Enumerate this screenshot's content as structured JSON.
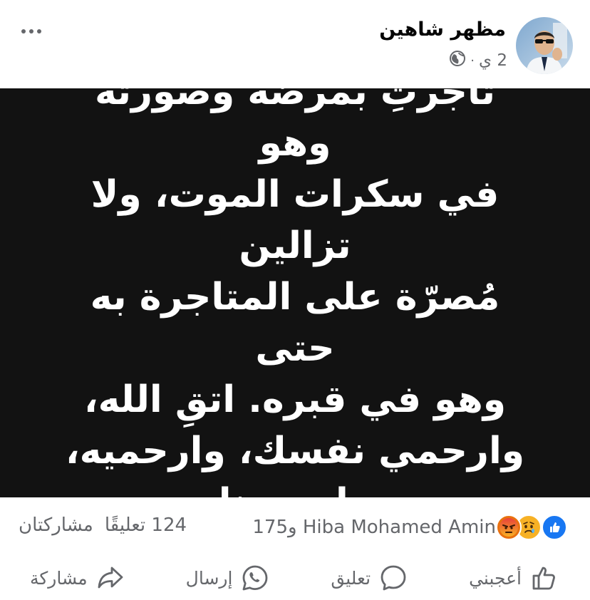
{
  "post": {
    "author": "مظهر شاهين",
    "time": "2 ي",
    "separator": "·",
    "privacy_icon": "globe-icon",
    "text_lines": [
      "تاجرتِ بمرضه وصورته وهو",
      "في سكرات الموت، ولا تزالين",
      "مُصرّة على المتاجرة به حتى",
      "وهو في قبره. اتقِ الله،",
      "وارحمي نفسك، وارحميه،",
      "وارحمينا"
    ],
    "background_color": "#121212"
  },
  "stats": {
    "reaction_icons": [
      "like-icon",
      "sad-icon",
      "angry-icon"
    ],
    "reactors": "Hiba Mohamed Amin و175",
    "comments": "124 تعليقًا",
    "shares": "مشاركتان"
  },
  "actions": {
    "like": "أعجبني",
    "comment": "تعليق",
    "send": "إرسال",
    "share": "مشاركة"
  },
  "colors": {
    "like_blue": "#1877f2",
    "muted_text": "#65676b"
  }
}
